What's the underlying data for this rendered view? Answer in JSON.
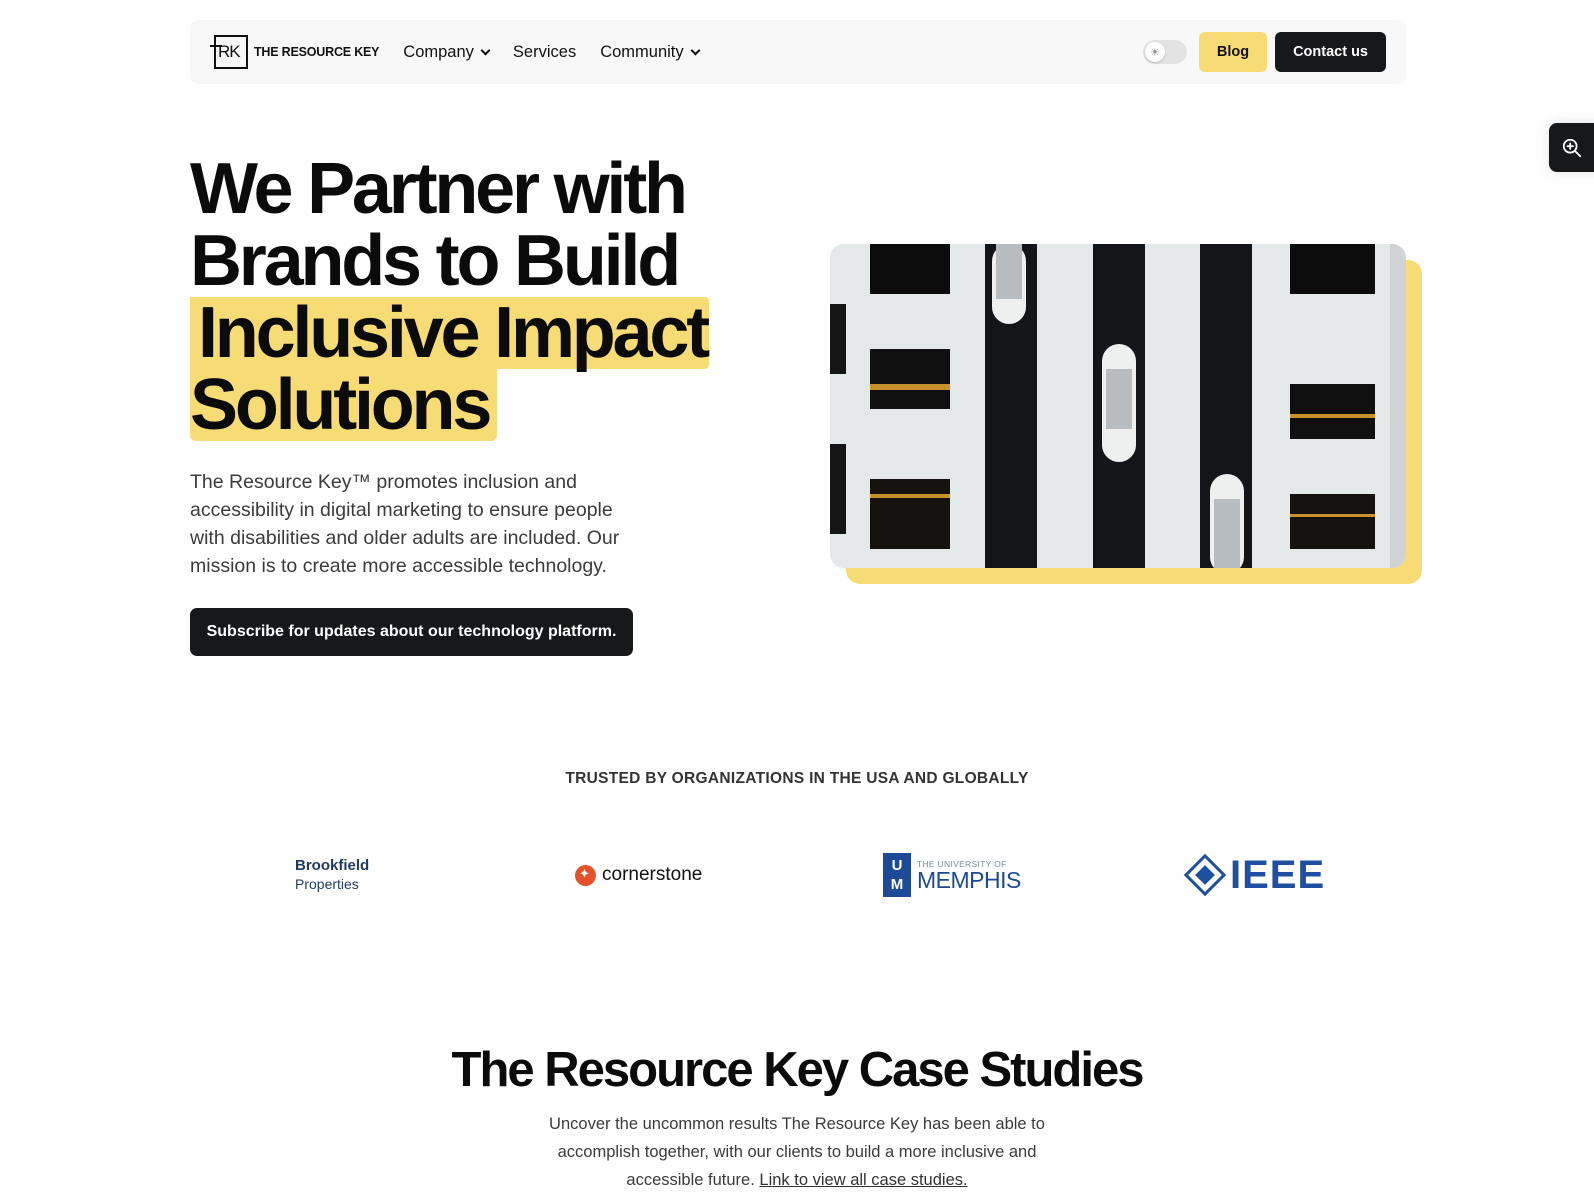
{
  "nav": {
    "logo_mark": "RK",
    "logo_text": "THE RESOURCE KEY",
    "links": [
      {
        "label": "Company",
        "has_dropdown": true
      },
      {
        "label": "Services",
        "has_dropdown": false
      },
      {
        "label": "Community",
        "has_dropdown": true
      }
    ],
    "theme_toggle_icon": "sun-icon",
    "blog_label": "Blog",
    "contact_label": "Contact us"
  },
  "zoom_widget": {
    "icon": "zoom-in-icon"
  },
  "hero": {
    "title_line1": "We Partner with",
    "title_line2": "Brands to Build",
    "title_highlight1": "Inclusive Impact",
    "title_highlight2": "Solutions",
    "description": "The Resource Key™ promotes inclusion and accessibility in digital marketing to ensure people with disabilities and older adults are included. Our mission is to create more accessible technology.",
    "cta_label": "Subscribe for updates about our technology platform.",
    "image_alt": "Atrium with glass elevators"
  },
  "trusted": {
    "heading": "TRUSTED BY ORGANIZATIONS IN THE USA AND GLOBALLY",
    "logos": [
      {
        "name": "Brookfield",
        "sub": "Properties"
      },
      {
        "name": "cornerstone"
      },
      {
        "name": "MEMPHIS",
        "sub": "THE UNIVERSITY OF",
        "mark": "UM"
      },
      {
        "name": "IEEE"
      }
    ]
  },
  "case_studies": {
    "title": "The Resource Key Case Studies",
    "description": "Uncover the uncommon results The Resource Key has been able to accomplish together, with our clients to build a more inclusive and accessible future.",
    "link_label": "Link to view all case studies."
  },
  "colors": {
    "accent_yellow": "#f7dc76",
    "dark": "#17181a",
    "ieee_blue": "#1f4fa0",
    "memphis_blue": "#1d4a96",
    "cornerstone_orange": "#e5532d"
  }
}
